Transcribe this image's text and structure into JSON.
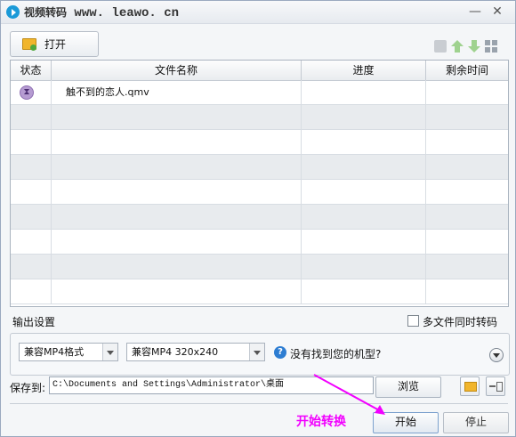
{
  "title_bar": {
    "title_zh": "视频转码",
    "title_url": " www. leawo. cn",
    "minimize": "—",
    "close": "✕"
  },
  "toolbar": {
    "open_label": "打开"
  },
  "table": {
    "columns": [
      "状态",
      "文件名称",
      "进度",
      "剩余时间"
    ],
    "rows": [
      {
        "status": "⧗",
        "filename": "触不到的恋人.qmv",
        "progress": "",
        "remaining": ""
      }
    ]
  },
  "output": {
    "section_label": "输出设置",
    "multi_convert_label": "多文件同时转码",
    "multi_convert_checked": false,
    "format_select": "兼容MP4格式",
    "profile_select": "兼容MP4 320x240",
    "help_text": "没有找到您的机型?"
  },
  "save": {
    "label": "保存到:",
    "path": "C:\\Documents and Settings\\Administrator\\桌面",
    "browse_label": "浏览"
  },
  "actions": {
    "start_label": "开始",
    "stop_label": "停止"
  },
  "annotation": {
    "text": "开始转换",
    "color": "#f200ff"
  }
}
